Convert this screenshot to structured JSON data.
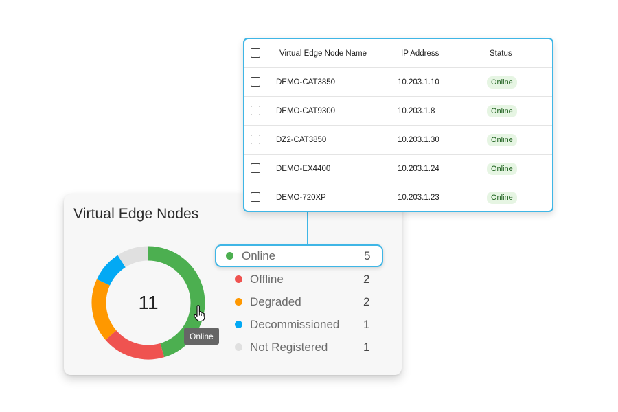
{
  "summary": {
    "title": "Virtual Edge Nodes",
    "total": "11",
    "tooltip": "Online",
    "statuses": [
      {
        "label": "Online",
        "count": "5",
        "value": 5,
        "color": "#4caf50"
      },
      {
        "label": "Offline",
        "count": "2",
        "value": 2,
        "color": "#ef5350"
      },
      {
        "label": "Degraded",
        "count": "2",
        "value": 2,
        "color": "#ff9800"
      },
      {
        "label": "Decommissioned",
        "count": "1",
        "value": 1,
        "color": "#03a9f4"
      },
      {
        "label": "Not Registered",
        "count": "1",
        "value": 1,
        "color": "#e0e0e0"
      }
    ]
  },
  "table": {
    "columns": [
      "Virtual Edge Node Name",
      "IP Address",
      "Status"
    ],
    "rows": [
      {
        "name": "DEMO-CAT3850",
        "ip": "10.203.1.10",
        "status": "Online"
      },
      {
        "name": "DEMO-CAT9300",
        "ip": "10.203.1.8",
        "status": "Online"
      },
      {
        "name": "DZ2-CAT3850",
        "ip": "10.203.1.30",
        "status": "Online"
      },
      {
        "name": "DEMO-EX4400",
        "ip": "10.203.1.24",
        "status": "Online"
      },
      {
        "name": "DEMO-720XP",
        "ip": "10.203.1.23",
        "status": "Online"
      }
    ]
  },
  "colors": {
    "accent": "#3fb6e6",
    "badge_bg": "#e6f5e3",
    "badge_text": "#1a5e1a"
  },
  "icons": {
    "cursor": "hand-pointer-icon",
    "status_dot": "status-dot-icon"
  }
}
